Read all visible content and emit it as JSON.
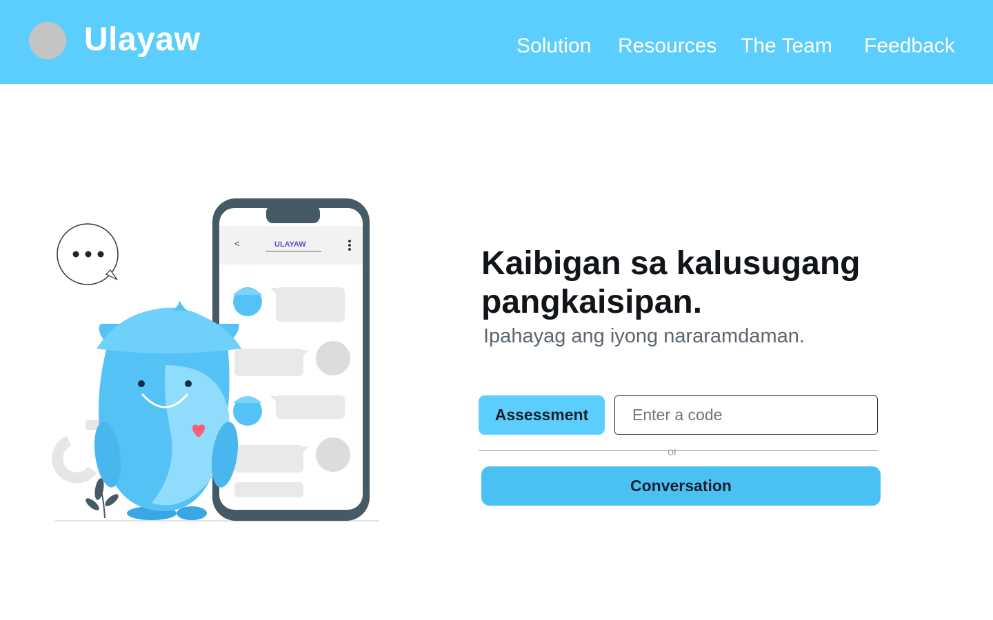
{
  "header": {
    "brand": "Ulayaw",
    "nav": {
      "solution": "Solution",
      "resources": "Resources",
      "team": "The Team",
      "feedback": "Feedback"
    }
  },
  "phone": {
    "app_title": "ULAYAW",
    "back_glyph": "<"
  },
  "hero": {
    "title": "Kaibigan sa kalusugang pangkaisipan.",
    "subtitle": "Ipahayag ang iyong nararamdaman."
  },
  "actions": {
    "assessment_label": "Assessment",
    "code_placeholder": "Enter a code",
    "or_label": "or",
    "conversation_label": "Conversation"
  },
  "colors": {
    "header_bg": "#5ccefd",
    "button_bg": "#5ccefd",
    "conversation_bg": "#4bc1f3",
    "mascot_blue": "#55c2f5",
    "heart": "#ff5c7a"
  },
  "icons": {
    "logo": "logo-placeholder-circle",
    "speech_bubble": "ellipsis-speech-bubble-icon",
    "phone_menu": "vertical-dots-icon"
  }
}
